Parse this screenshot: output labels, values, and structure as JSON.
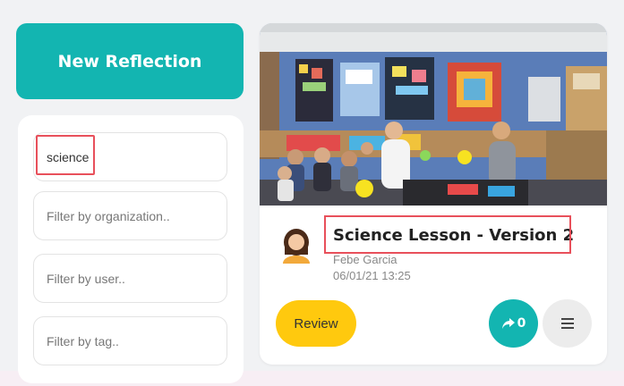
{
  "sidebar": {
    "new_reflection_label": "New Reflection",
    "filters": {
      "search_value": "science",
      "organization_placeholder": "Filter by organization..",
      "user_placeholder": "Filter by user..",
      "tag_placeholder": "Filter by tag.."
    }
  },
  "card": {
    "title": "Science Lesson - Version 2",
    "author": "Febe Garcia",
    "timestamp": "06/01/21 13:25",
    "review_label": "Review",
    "share_count": "0",
    "icons": {
      "avatar": "avatar-icon",
      "share": "share-icon",
      "menu": "hamburger-menu-icon"
    },
    "thumbnail": {
      "type": "classroom-photo"
    }
  },
  "colors": {
    "teal": "#13b5b1",
    "yellow": "#ffc90e",
    "highlight": "#e8505b"
  }
}
